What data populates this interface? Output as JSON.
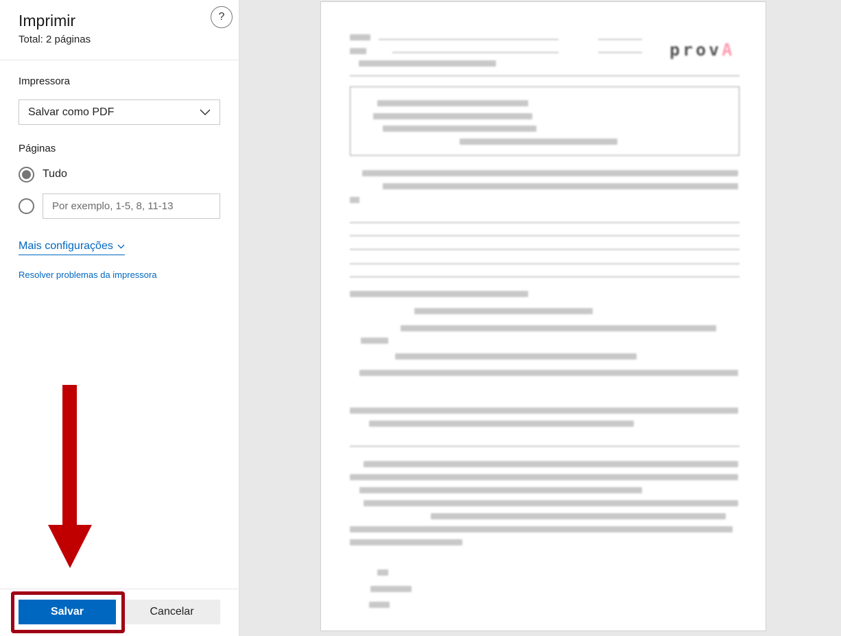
{
  "dialog": {
    "title": "Imprimir",
    "total": "Total: 2 páginas",
    "help_glyph": "?",
    "printer_label": "Impressora",
    "printer_value": "Salvar como PDF",
    "pages_label": "Páginas",
    "all_option": "Tudo",
    "range_placeholder": "Por exemplo, 1-5, 8, 11-13",
    "more_settings": "Mais configurações",
    "troubleshoot": "Resolver problemas da impressora",
    "save_button": "Salvar",
    "cancel_button": "Cancelar"
  },
  "preview": {
    "logo_main": "prov",
    "logo_accent": "A"
  },
  "colors": {
    "accent": "#0067c0",
    "highlight": "#a00014",
    "arrow": "#c00000"
  },
  "icons": [
    "help-icon",
    "chevron-down-icon",
    "radio-icon",
    "down-arrow-annotation"
  ]
}
